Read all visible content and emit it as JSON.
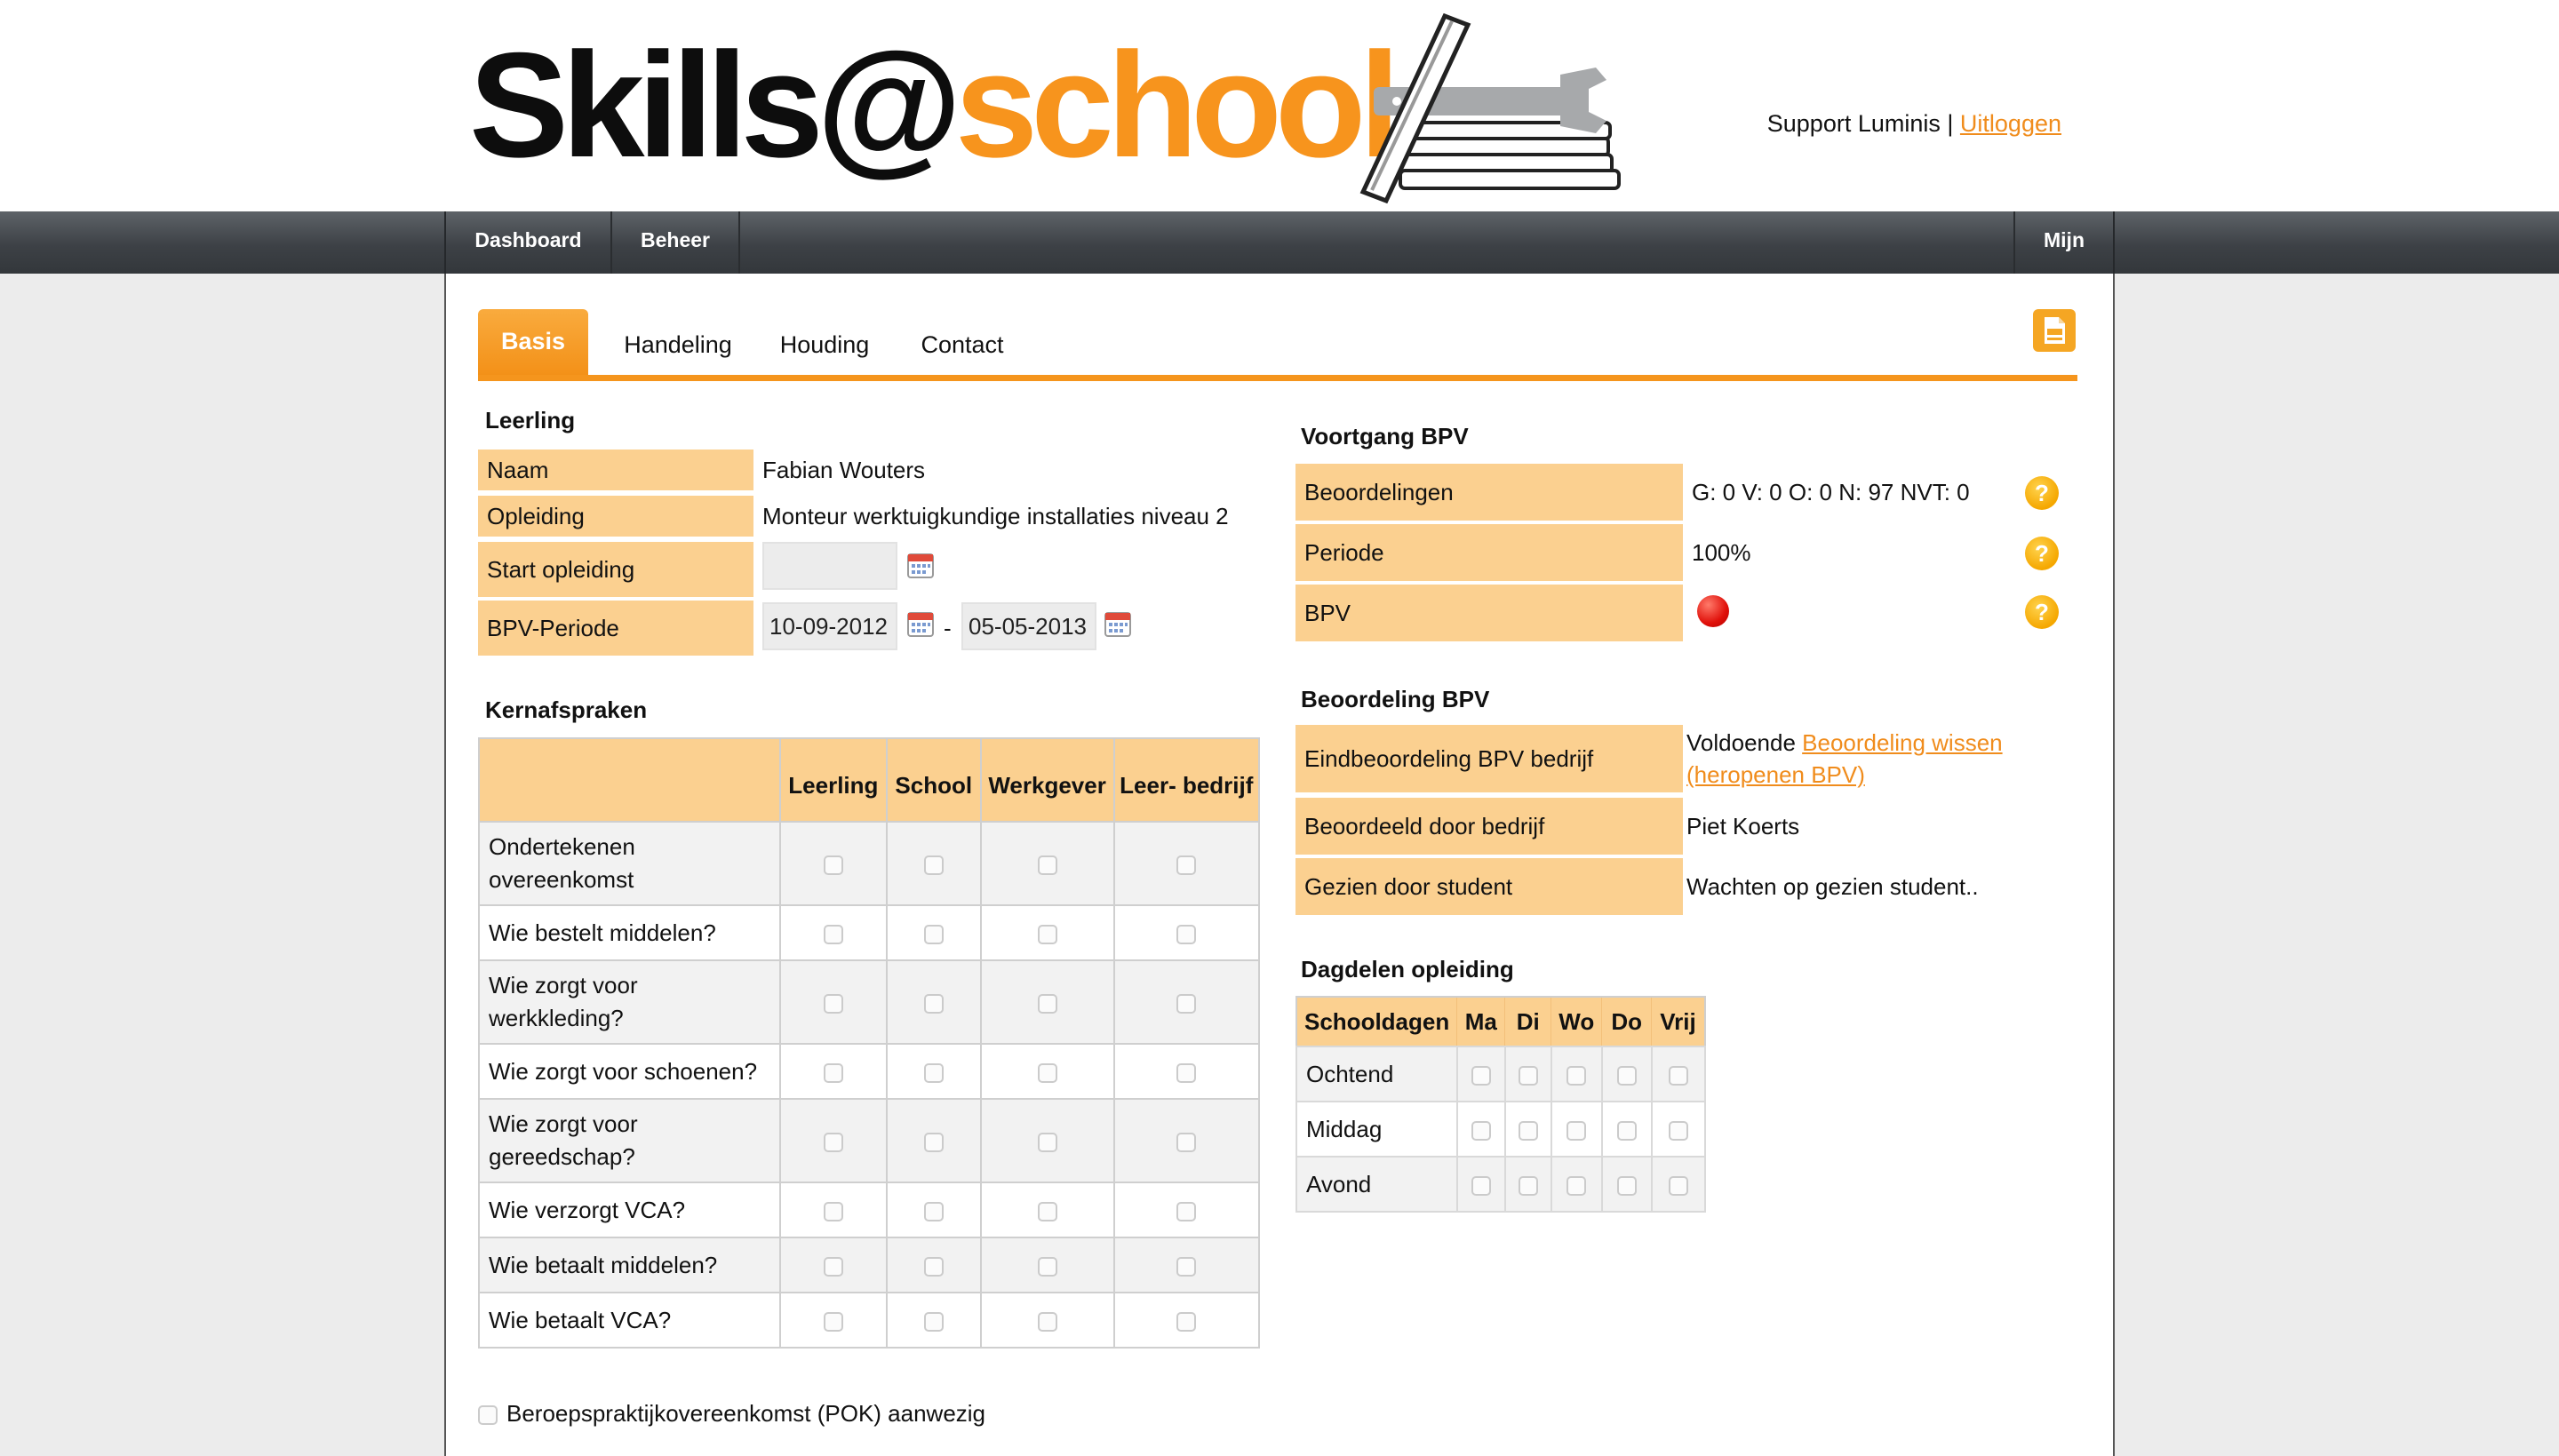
{
  "brand": {
    "name_part1": "Skills@",
    "name_part2": "school",
    "orange": "#f7941d",
    "dark": "#0d0d0d"
  },
  "user": {
    "name": "Support Luminis",
    "separator": "|",
    "logout_label": "Uitloggen"
  },
  "nav": {
    "dashboard": "Dashboard",
    "beheer": "Beheer",
    "mijn": "Mijn"
  },
  "tabs": {
    "basis": "Basis",
    "handeling": "Handeling",
    "houding": "Houding",
    "contact": "Contact",
    "active": "Basis"
  },
  "leerling": {
    "title": "Leerling",
    "naam_label": "Naam",
    "naam_value": "Fabian Wouters",
    "opleiding_label": "Opleiding",
    "opleiding_value": "Monteur werktuigkundige installaties niveau 2",
    "start_label": "Start opleiding",
    "start_value": "",
    "bpv_label": "BPV-Periode",
    "bpv_from": "10-09-2012",
    "bpv_dash": "-",
    "bpv_to": "05-05-2013"
  },
  "kernafspraken": {
    "title": "Kernafspraken",
    "headers": [
      "Leerling",
      "School",
      "Werkgever",
      "Leer- bedrijf"
    ],
    "rows": [
      "Ondertekenen overeenkomst",
      "Wie bestelt middelen?",
      "Wie zorgt voor werkkleding?",
      "Wie zorgt voor schoenen?",
      "Wie zorgt voor gereedschap?",
      "Wie verzorgt VCA?",
      "Wie betaalt middelen?",
      "Wie betaalt VCA?"
    ]
  },
  "voortgang": {
    "title": "Voortgang BPV",
    "beoordelingen_label": "Beoordelingen",
    "beoordelingen_value": "G: 0 V: 0 O: 0 N: 97 NVT: 0",
    "periode_label": "Periode",
    "periode_value": "100%",
    "bpv_label": "BPV",
    "bpv_status_color": "#e0100a"
  },
  "beoordeling": {
    "title": "Beoordeling BPV",
    "eind_label": "Eindbeoordeling BPV bedrijf",
    "eind_value": "Voldoende",
    "eind_link1": "Beoordeling wissen",
    "eind_link2": "(heropenen BPV)",
    "door_bedrijf_label": "Beoordeeld door bedrijf",
    "door_bedrijf_value": "Piet Koerts",
    "gezien_label": "Gezien door student",
    "gezien_value": "Wachten op gezien student.."
  },
  "dagdelen": {
    "title": "Dagdelen opleiding",
    "headers": [
      "Schooldagen",
      "Ma",
      "Di",
      "Wo",
      "Do",
      "Vrij"
    ],
    "rows": [
      "Ochtend",
      "Middag",
      "Avond"
    ]
  },
  "pok": {
    "label": "Beroepspraktijkovereenkomst (POK) aanwezig"
  },
  "icons": {
    "calendar": "calendar-icon",
    "help": "help-icon",
    "pdf": "pdf-icon"
  }
}
